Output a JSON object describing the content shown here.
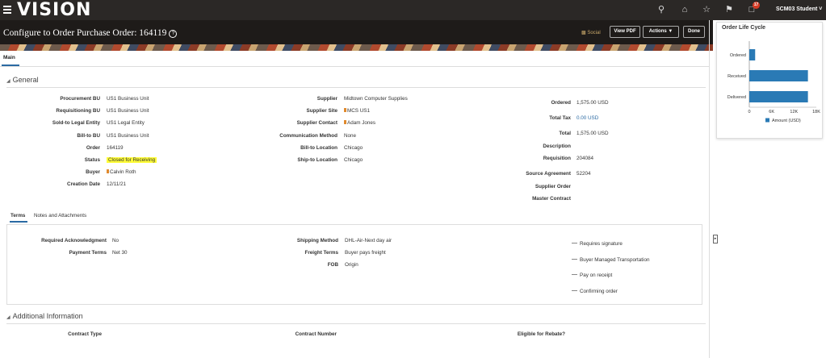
{
  "app": {
    "logo": "VISION",
    "user": "SCM03 Student",
    "notification_count": "17"
  },
  "header": {
    "title": "Configure to Order Purchase Order: 164119",
    "help_icon": "help-icon",
    "social_label": "Social",
    "view_pdf_label": "View PDF",
    "actions_label": "Actions",
    "done_label": "Done"
  },
  "tabs": {
    "main": "Main"
  },
  "general": {
    "title": "General",
    "left": [
      {
        "label": "Procurement BU",
        "value": "US1 Business Unit"
      },
      {
        "label": "Requisitioning BU",
        "value": "US1 Business Unit"
      },
      {
        "label": "Sold-to Legal Entity",
        "value": "US1 Legal Entity"
      },
      {
        "label": "Bill-to BU",
        "value": "US1 Business Unit"
      },
      {
        "label": "Order",
        "value": "164119"
      },
      {
        "label": "Status",
        "value": "Closed for Receiving"
      },
      {
        "label": "Buyer",
        "value": "Calvin Roth"
      },
      {
        "label": "Creation Date",
        "value": "12/11/21"
      }
    ],
    "middle": [
      {
        "label": "Supplier",
        "value": "Midtown Computer Supplies"
      },
      {
        "label": "Supplier Site",
        "value": "MCS US1"
      },
      {
        "label": "Supplier Contact",
        "value": "Adam Jones"
      },
      {
        "label": "Communication Method",
        "value": "None"
      },
      {
        "label": "Bill-to Location",
        "value": "Chicago"
      },
      {
        "label": "Ship-to Location",
        "value": "Chicago"
      }
    ],
    "right": [
      {
        "label": "Ordered",
        "value": "1,575.00 USD"
      },
      {
        "label": "Total Tax",
        "value": "0.00 USD"
      },
      {
        "label": "Total",
        "value": "1,575.00 USD"
      },
      {
        "label": "Description",
        "value": ""
      },
      {
        "label": "Requisition",
        "value": "204084"
      },
      {
        "label": "Source Agreement",
        "value": "52204"
      },
      {
        "label": "Supplier Order",
        "value": ""
      },
      {
        "label": "Master Contract",
        "value": ""
      }
    ]
  },
  "subtabs": {
    "terms": "Terms",
    "notes": "Notes and Attachments"
  },
  "terms": {
    "left": [
      {
        "label": "Required Acknowledgment",
        "value": "No"
      },
      {
        "label": "Payment Terms",
        "value": "Net 30"
      }
    ],
    "middle": [
      {
        "label": "Shipping Method",
        "value": "DHL-Air-Next day air"
      },
      {
        "label": "Freight Terms",
        "value": "Buyer pays freight"
      },
      {
        "label": "FOB",
        "value": "Origin"
      }
    ],
    "checks": [
      {
        "label": "Requires signature"
      },
      {
        "label": "Buyer Managed Transportation"
      },
      {
        "label": "Pay on receipt"
      },
      {
        "label": "Confirming order"
      }
    ]
  },
  "additional": {
    "title": "Additional Information",
    "contract_type": "Contract Type",
    "contract_number": "Contract Number",
    "rebate": "Eligible for Rebate?"
  },
  "lifecycle": {
    "title": "Order Life Cycle"
  },
  "chart_data": {
    "type": "bar",
    "orientation": "horizontal",
    "categories": [
      "Ordered",
      "Received",
      "Delivered"
    ],
    "series": [
      {
        "name": "Amount (USD)",
        "values": [
          1575,
          15750,
          15750
        ]
      }
    ],
    "xlim": [
      0,
      18000
    ],
    "ticks": [
      "0",
      "6K",
      "12K",
      "18K"
    ],
    "bar_color": "#2a7ab5",
    "legend": "bottom"
  }
}
